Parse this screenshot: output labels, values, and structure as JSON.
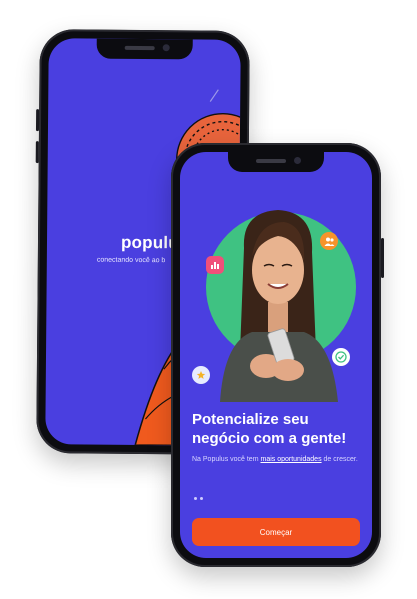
{
  "splash": {
    "brand_name": "populus",
    "tagline": "conectando você ao b"
  },
  "onboarding": {
    "headline_line1": "Potencialize seu",
    "headline_line2": "negócio com a gente!",
    "subtitle_prefix": "Na Populus você tem ",
    "subtitle_link": "mais oportunidades",
    "subtitle_suffix": " de crescer.",
    "start_button_label": "Começar"
  },
  "colors": {
    "background_blue": "#4a3fe0",
    "accent_orange": "#f2511f",
    "hero_green": "#3fc282",
    "badge_pink": "#f0507a",
    "badge_orange": "#f7932b"
  },
  "icons": [
    "chart-icon",
    "users-icon",
    "check-circle-icon",
    "star-icon"
  ]
}
